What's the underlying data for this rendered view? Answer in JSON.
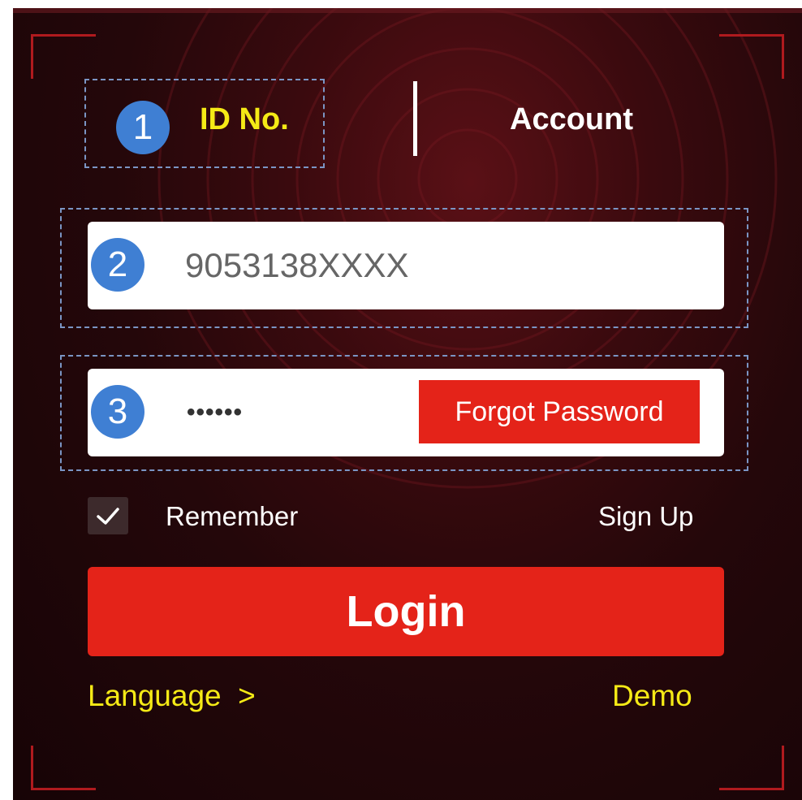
{
  "tabs": [
    {
      "label": "ID No.",
      "active": true
    },
    {
      "label": "Account",
      "active": false
    }
  ],
  "badges": [
    "1",
    "2",
    "3"
  ],
  "id_field": {
    "value": "9053138XXXX"
  },
  "password_field": {
    "masked_value": "••••••",
    "forgot_label": "Forgot Password"
  },
  "remember": {
    "label": "Remember",
    "checked": true
  },
  "signup_label": "Sign Up",
  "login_label": "Login",
  "language_label": "Language  >",
  "demo_label": "Demo",
  "colors": {
    "accent_red": "#e42319",
    "active_tab_yellow": "#f5ea16",
    "badge_blue": "#3f7fd3",
    "background_dark_red": "#24070a"
  }
}
